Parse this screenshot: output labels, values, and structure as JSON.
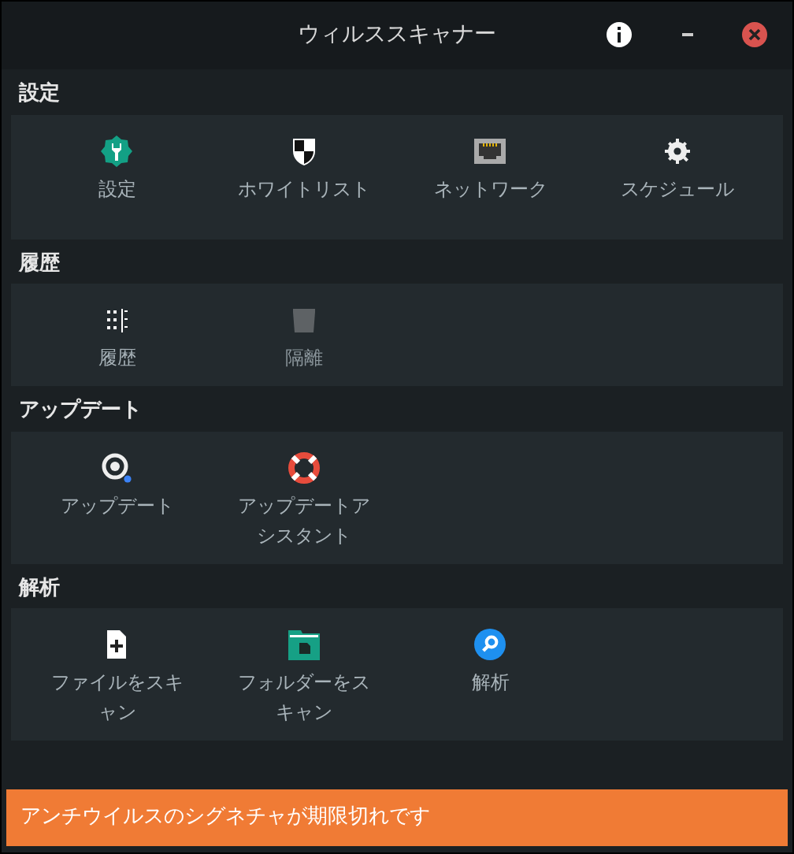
{
  "window": {
    "title": "ウィルススキャナー"
  },
  "sections": [
    {
      "title": "設定",
      "items": [
        {
          "kind": "settings",
          "label": "設定",
          "disabled": false
        },
        {
          "kind": "whitelist",
          "label": "ホワイトリスト",
          "disabled": false
        },
        {
          "kind": "network",
          "label": "ネットワーク",
          "disabled": false
        },
        {
          "kind": "schedule",
          "label": "スケジュール",
          "disabled": false
        }
      ]
    },
    {
      "title": "履歴",
      "items": [
        {
          "kind": "history",
          "label": "履歴",
          "disabled": false
        },
        {
          "kind": "quarantine",
          "label": "隔離",
          "disabled": true
        }
      ]
    },
    {
      "title": "アップデート",
      "items": [
        {
          "kind": "update",
          "label": "アップデート",
          "disabled": false
        },
        {
          "kind": "assistant",
          "label": "アップデートアシスタント",
          "disabled": false
        }
      ]
    },
    {
      "title": "解析",
      "items": [
        {
          "kind": "scan-file",
          "label": "ファイルをスキャン",
          "disabled": false
        },
        {
          "kind": "scan-folder",
          "label": "フォルダーをスキャン",
          "disabled": false
        },
        {
          "kind": "analysis",
          "label": "解析",
          "disabled": false
        }
      ]
    }
  ],
  "status_bar": {
    "message": "アンチウイルスのシグネチャが期限切れです"
  }
}
